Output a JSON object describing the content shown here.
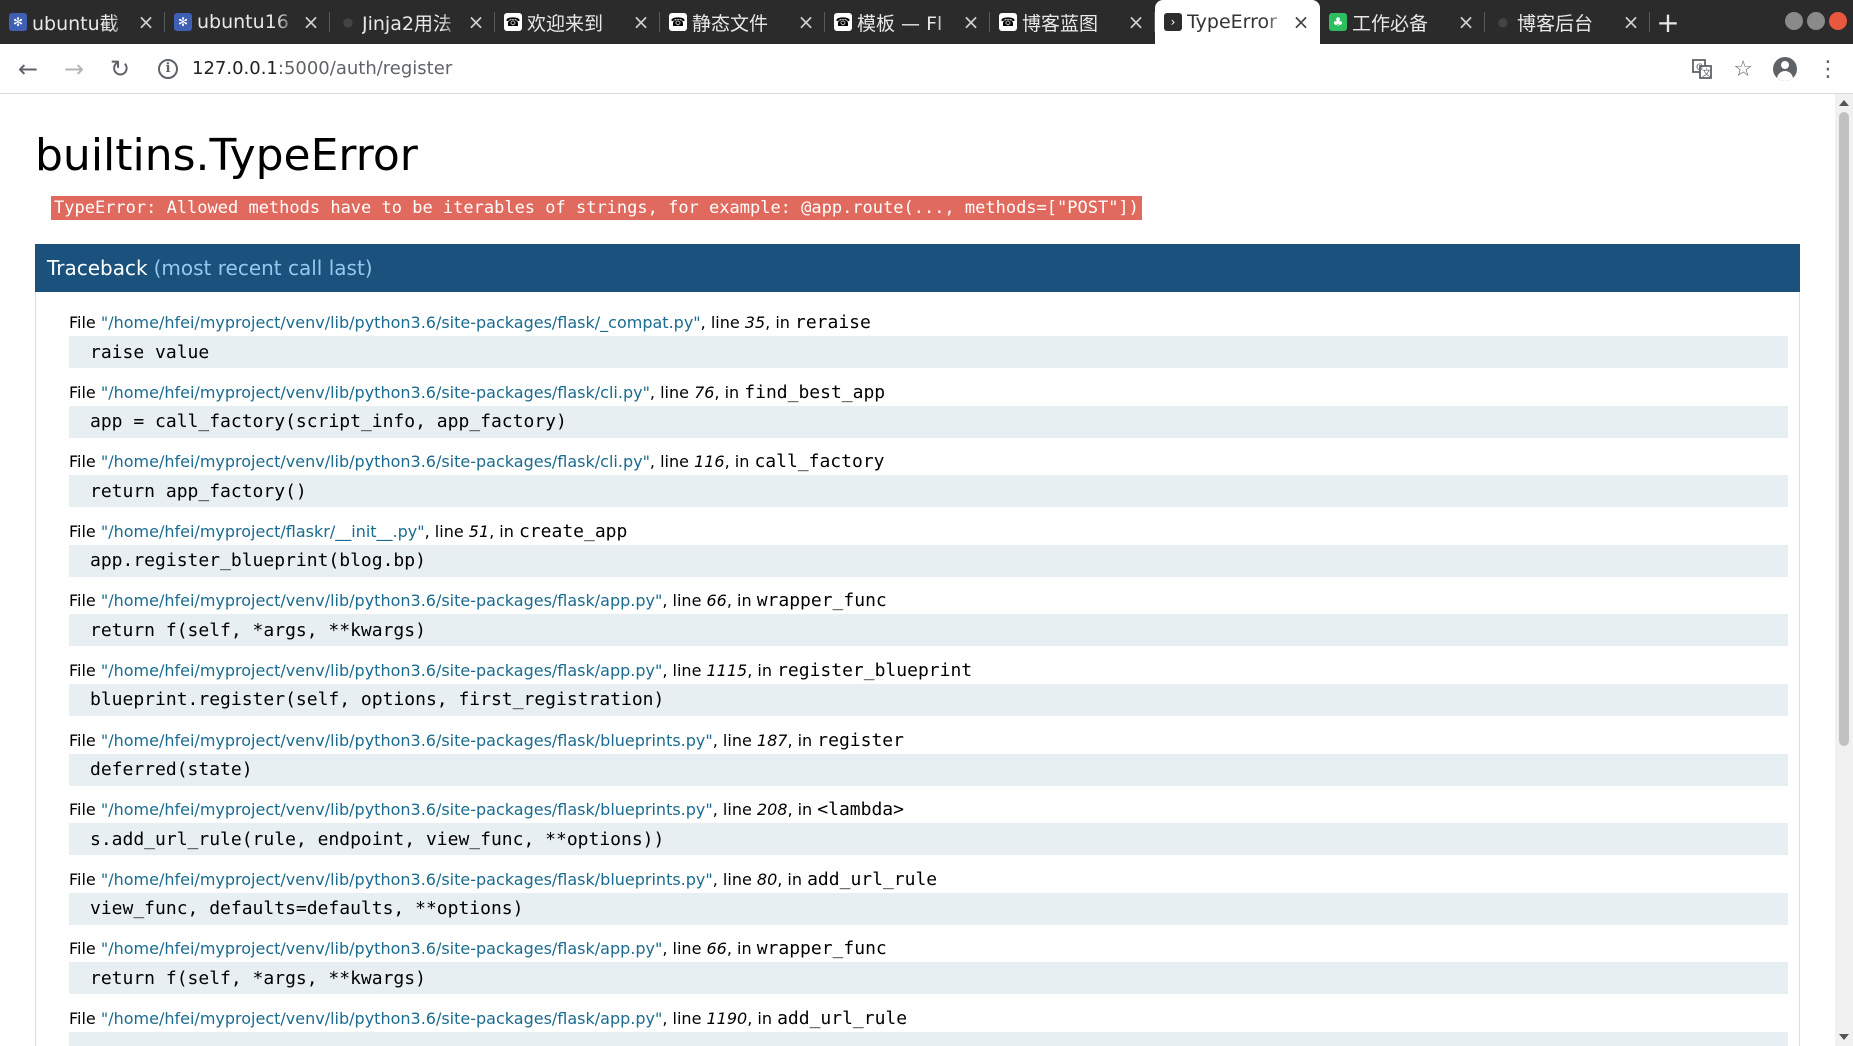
{
  "browser": {
    "tabs": [
      {
        "title": "ubuntu截",
        "favicon": "gear-favicon-icon",
        "active": false
      },
      {
        "title": "ubuntu16",
        "favicon": "gear-favicon-icon",
        "active": false
      },
      {
        "title": "Jinja2用法",
        "favicon": "github-favicon-icon",
        "active": false
      },
      {
        "title": "欢迎来到",
        "favicon": "flask-horn-favicon-icon",
        "active": false
      },
      {
        "title": "静态文件",
        "favicon": "flask-horn-favicon-icon",
        "active": false
      },
      {
        "title": "模板 — Fl",
        "favicon": "flask-horn-favicon-icon",
        "active": false
      },
      {
        "title": "博客蓝图",
        "favicon": "flask-horn-favicon-icon",
        "active": false
      },
      {
        "title": "TypeError",
        "favicon": "terminal-favicon-icon",
        "active": true
      },
      {
        "title": "工作必备",
        "favicon": "evernote-favicon-icon",
        "active": false
      },
      {
        "title": "博客后台",
        "favicon": "github-favicon-icon",
        "active": false
      }
    ],
    "new_tab_label": "+",
    "url_host": "127.0.0.1",
    "url_rest": ":5000/auth/register"
  },
  "error": {
    "title": "builtins.TypeError",
    "message": "TypeError: Allowed methods have to be iterables of strings, for example: @app.route(..., methods=[\"POST\"])"
  },
  "traceback": {
    "heading": "Traceback",
    "subheading": "(most recent call last)",
    "frames": [
      {
        "file": "\"/home/hfei/myproject/venv/lib/python3.6/site-packages/flask/_compat.py\"",
        "line": "35",
        "func": "reraise",
        "code": "raise value"
      },
      {
        "file": "\"/home/hfei/myproject/venv/lib/python3.6/site-packages/flask/cli.py\"",
        "line": "76",
        "func": "find_best_app",
        "code": "app = call_factory(script_info, app_factory)"
      },
      {
        "file": "\"/home/hfei/myproject/venv/lib/python3.6/site-packages/flask/cli.py\"",
        "line": "116",
        "func": "call_factory",
        "code": "return app_factory()"
      },
      {
        "file": "\"/home/hfei/myproject/flaskr/__init__.py\"",
        "line": "51",
        "func": "create_app",
        "code": "app.register_blueprint(blog.bp)"
      },
      {
        "file": "\"/home/hfei/myproject/venv/lib/python3.6/site-packages/flask/app.py\"",
        "line": "66",
        "func": "wrapper_func",
        "code": "return f(self, *args, **kwargs)"
      },
      {
        "file": "\"/home/hfei/myproject/venv/lib/python3.6/site-packages/flask/app.py\"",
        "line": "1115",
        "func": "register_blueprint",
        "code": "blueprint.register(self, options, first_registration)"
      },
      {
        "file": "\"/home/hfei/myproject/venv/lib/python3.6/site-packages/flask/blueprints.py\"",
        "line": "187",
        "func": "register",
        "code": "deferred(state)"
      },
      {
        "file": "\"/home/hfei/myproject/venv/lib/python3.6/site-packages/flask/blueprints.py\"",
        "line": "208",
        "func": "<lambda>",
        "code": "s.add_url_rule(rule, endpoint, view_func, **options))"
      },
      {
        "file": "\"/home/hfei/myproject/venv/lib/python3.6/site-packages/flask/blueprints.py\"",
        "line": "80",
        "func": "add_url_rule",
        "code": "view_func, defaults=defaults, **options)"
      },
      {
        "file": "\"/home/hfei/myproject/venv/lib/python3.6/site-packages/flask/app.py\"",
        "line": "66",
        "func": "wrapper_func",
        "code": "return f(self, *args, **kwargs)"
      },
      {
        "file": "\"/home/hfei/myproject/venv/lib/python3.6/site-packages/flask/app.py\"",
        "line": "1190",
        "func": "add_url_rule",
        "code": ""
      }
    ]
  },
  "colors": {
    "traceback_header": "#1a527d",
    "error_highlight": "#e06a5e",
    "file_link": "#1a6b8f",
    "code_background": "#e8eff2"
  }
}
